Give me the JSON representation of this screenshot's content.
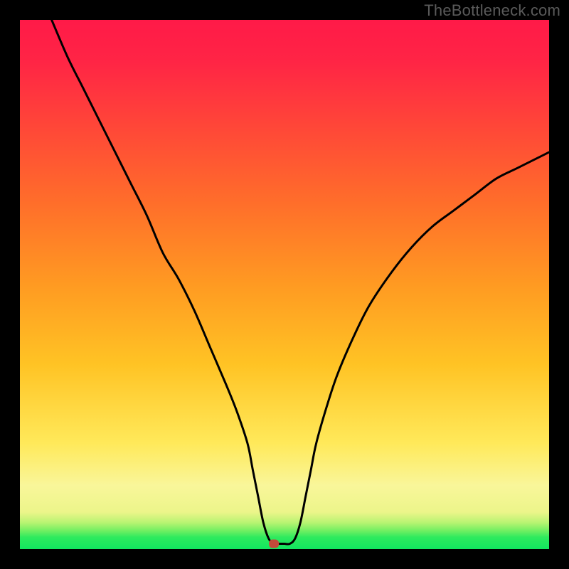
{
  "watermark": "TheBottleneck.com",
  "chart_data": {
    "type": "line",
    "title": "",
    "xlabel": "",
    "ylabel": "",
    "xlim": [
      0,
      100
    ],
    "ylim": [
      0,
      100
    ],
    "bands": [
      {
        "name": "green",
        "from": 0,
        "to": 3,
        "color": "#12e65f"
      },
      {
        "name": "lime",
        "from": 3,
        "to": 6,
        "color": "#8af263"
      },
      {
        "name": "pale-yellow",
        "from": 6,
        "to": 18,
        "color": "#f8f79a"
      },
      {
        "name": "yellow",
        "from": 18,
        "to": 45,
        "color": "#ffd93a"
      },
      {
        "name": "orange",
        "from": 45,
        "to": 75,
        "color": "#ff8a2a"
      },
      {
        "name": "red",
        "from": 75,
        "to": 100,
        "color": "#ff1f47"
      }
    ],
    "curve": {
      "x": [
        6,
        9,
        12,
        15,
        18,
        21,
        24,
        27,
        30,
        33,
        36,
        39,
        41,
        43,
        44,
        45,
        46,
        47,
        48,
        49,
        50,
        51,
        52,
        53,
        54,
        55,
        56,
        58,
        60,
        63,
        66,
        70,
        74,
        78,
        82,
        86,
        90,
        94,
        98,
        100
      ],
      "y": [
        100,
        93,
        87,
        81,
        75,
        69,
        63,
        56,
        51,
        45,
        38,
        31,
        26,
        20,
        15,
        10,
        5,
        2,
        1,
        1,
        1,
        1,
        2,
        5,
        10,
        15,
        20,
        27,
        33,
        40,
        46,
        52,
        57,
        61,
        64,
        67,
        70,
        72,
        74,
        75
      ]
    },
    "marker": {
      "x": 48,
      "y": 1,
      "color": "#c44a3a"
    }
  }
}
